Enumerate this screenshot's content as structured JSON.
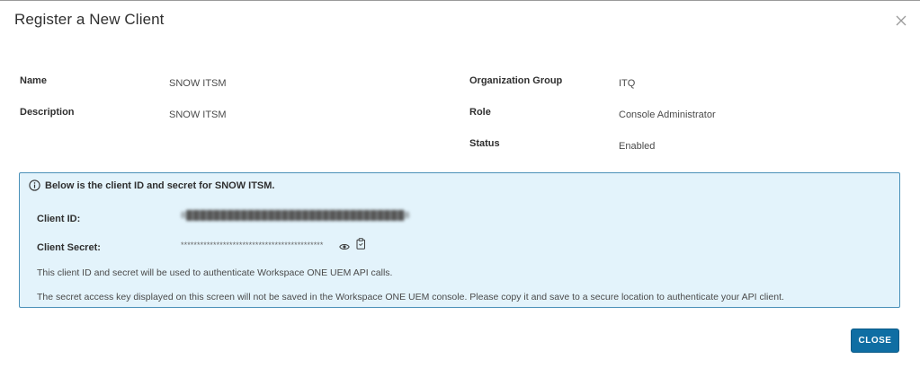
{
  "dialog": {
    "title": "Register a New Client",
    "close_icon": "close-icon"
  },
  "details": {
    "name_label": "Name",
    "name_value": "SNOW ITSM",
    "description_label": "Description",
    "description_value": "SNOW ITSM",
    "org_group_label": "Organization Group",
    "org_group_value": "ITQ",
    "role_label": "Role",
    "role_value": "Console Administrator",
    "status_label": "Status",
    "status_value": "Enabled"
  },
  "info_panel": {
    "icon": "info-circle-icon",
    "title": "Below is the client ID and secret for SNOW ITSM.",
    "client_id_label": "Client ID:",
    "client_id_value": "8████████████████████████████████8",
    "client_secret_label": "Client Secret:",
    "client_secret_value": "********************************************",
    "reveal_icon": "eye-icon",
    "copy_icon": "clipboard-copy-icon",
    "note_1": "This client ID and secret will be used to authenticate Workspace ONE UEM API calls.",
    "note_2": "The secret access key displayed on this screen will not be saved in the Workspace ONE UEM console. Please copy it and save to a secure location to authenticate your API client."
  },
  "footer": {
    "close_label": "CLOSE"
  },
  "colors": {
    "accent": "#0f6ea3",
    "panel_bg": "#e3f3fb",
    "panel_border": "#4a90b8"
  }
}
